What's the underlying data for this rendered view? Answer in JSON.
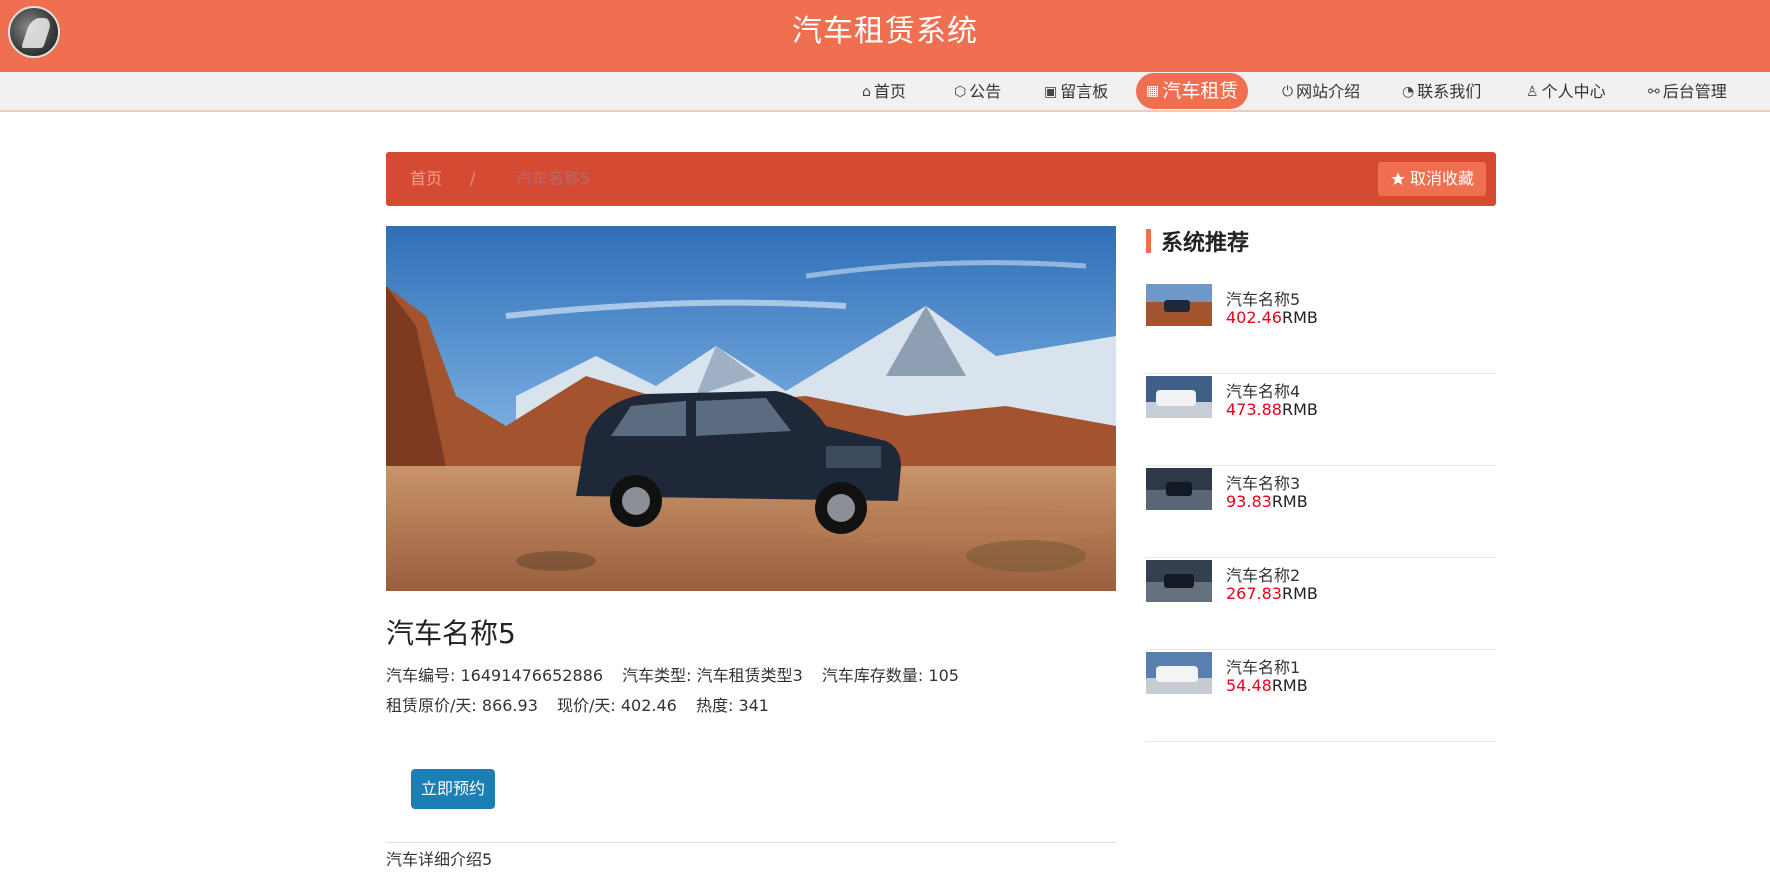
{
  "header": {
    "title": "汽车租赁系统"
  },
  "nav": [
    {
      "label": "首页",
      "icon": "home-icon",
      "glyph": "⌂"
    },
    {
      "label": "公告",
      "icon": "cube-icon",
      "glyph": "⬡"
    },
    {
      "label": "留言板",
      "icon": "gift-icon",
      "glyph": "▣"
    },
    {
      "label": "汽车租赁",
      "icon": "calendar-icon",
      "glyph": "▦",
      "active": true
    },
    {
      "label": "网站介绍",
      "icon": "power-icon",
      "glyph": "⏻"
    },
    {
      "label": "联系我们",
      "icon": "palette-icon",
      "glyph": "◔"
    },
    {
      "label": "个人中心",
      "icon": "user-icon",
      "glyph": "♙"
    },
    {
      "label": "后台管理",
      "icon": "link-icon",
      "glyph": "⚯"
    }
  ],
  "breadcrumb": {
    "home": "首页",
    "separator": "/",
    "current": "汽车名称5"
  },
  "favorite_button": {
    "label": "取消收藏",
    "icon": "star-icon"
  },
  "detail": {
    "name": "汽车名称5",
    "line1": {
      "code_label": "汽车编号:",
      "code_value": "16491476652886",
      "type_label": "汽车类型:",
      "type_value": "汽车租赁类型3",
      "stock_label": "汽车库存数量:",
      "stock_value": "105"
    },
    "line2": {
      "orig_label": "租赁原价/天:",
      "orig_value": "866.93",
      "now_label": "现价/天:",
      "now_value": "402.46",
      "heat_label": "热度:",
      "heat_value": "341"
    },
    "book_label": "立即预约",
    "description": "汽车详细介绍5"
  },
  "recommend": {
    "title": "系统推荐",
    "items": [
      {
        "name": "汽车名称5",
        "price": "402.46",
        "unit": "RMB"
      },
      {
        "name": "汽车名称4",
        "price": "473.88",
        "unit": "RMB"
      },
      {
        "name": "汽车名称3",
        "price": "93.83",
        "unit": "RMB"
      },
      {
        "name": "汽车名称2",
        "price": "267.83",
        "unit": "RMB"
      },
      {
        "name": "汽车名称1",
        "price": "54.48",
        "unit": "RMB"
      }
    ]
  },
  "colors": {
    "primary": "#f06f50",
    "crumb_bar": "#d44a32",
    "book_button": "#1b7fb3",
    "price": "#e8001c"
  }
}
